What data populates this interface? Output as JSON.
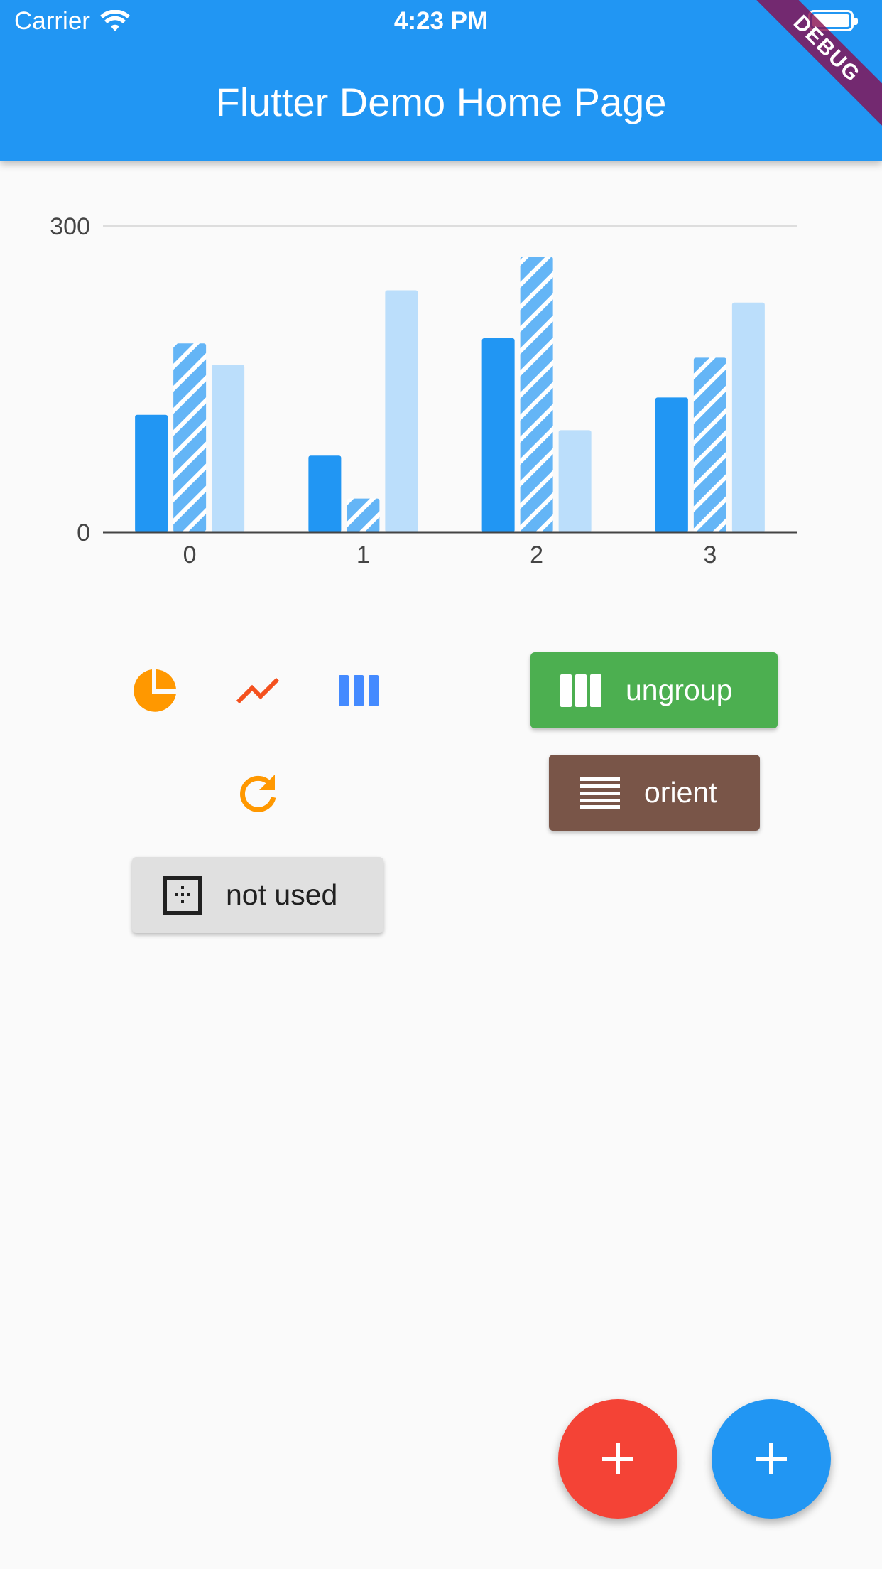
{
  "status_bar": {
    "carrier": "Carrier",
    "time": "4:23 PM"
  },
  "app_bar": {
    "title": "Flutter Demo Home Page"
  },
  "debug_banner": "DEBUG",
  "chart_data": {
    "type": "bar",
    "categories": [
      "0",
      "1",
      "2",
      "3"
    ],
    "series": [
      {
        "values": [
          115,
          75,
          190,
          132
        ],
        "color": "#2196f3",
        "pattern": "solid"
      },
      {
        "values": [
          185,
          33,
          270,
          171
        ],
        "color": "#64b5f6",
        "pattern": "hatched"
      },
      {
        "values": [
          164,
          237,
          100,
          225
        ],
        "color": "#bbdefb",
        "pattern": "solid"
      }
    ],
    "y_ticks": [
      "0",
      "300"
    ],
    "ylim": [
      0,
      300
    ],
    "grid": true
  },
  "icons": {
    "pie": {
      "name": "pie-chart-icon",
      "color": "#ff9800"
    },
    "line": {
      "name": "line-chart-icon",
      "color": "#f4511e"
    },
    "bar": {
      "name": "bar-chart-icon",
      "color": "#448aff"
    },
    "refresh": {
      "name": "refresh-icon",
      "color": "#ff9800"
    }
  },
  "buttons": {
    "ungroup": "ungroup",
    "orient": "orient",
    "not_used": "not used"
  },
  "colors": {
    "primary": "#2196f3",
    "green": "#4caf50",
    "brown": "#795548",
    "red": "#f44336"
  }
}
